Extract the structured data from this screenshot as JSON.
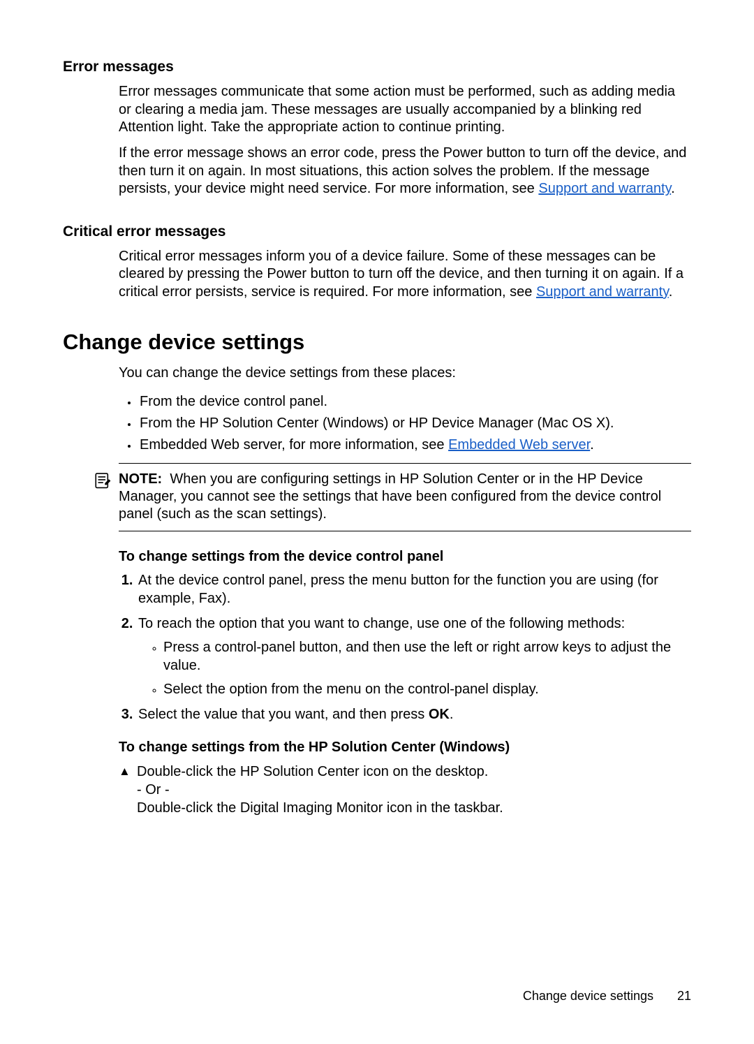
{
  "sec1": {
    "heading": "Error messages",
    "p1a": "Error messages communicate that some action must be performed, such as adding media or clearing a media jam. These messages are usually accompanied by a blinking red Attention light. Take the appropriate action to continue printing.",
    "p2a": "If the error message shows an error code, press the Power button to turn off the device, and then turn it on again. In most situations, this action solves the problem. If the message persists, your device might need service. For more information, see ",
    "p2link": "Support and warranty",
    "p2b": "."
  },
  "sec2": {
    "heading": "Critical error messages",
    "p1a": "Critical error messages inform you of a device failure. Some of these messages can be cleared by pressing the Power button to turn off the device, and then turning it on again. If a critical error persists, service is required. For more information, see ",
    "p1link": "Support and warranty",
    "p1b": "."
  },
  "sec3": {
    "heading": "Change device settings",
    "intro": "You can change the device settings from these places:",
    "bullets": {
      "b1": "From the device control panel.",
      "b2": "From the HP Solution Center (Windows) or HP Device Manager (Mac OS X).",
      "b3a": "Embedded Web server, for more information, see ",
      "b3link": "Embedded Web server",
      "b3b": "."
    },
    "note": {
      "label": "NOTE:",
      "text": "When you are configuring settings in HP Solution Center or in the HP Device Manager, you cannot see the settings that have been configured from the device control panel (such as the scan settings)."
    },
    "proc1": {
      "heading": "To change settings from the device control panel",
      "s1": "At the device control panel, press the menu button for the function you are using (for example, Fax).",
      "s2": "To reach the option that you want to change, use one of the following methods:",
      "s2a": "Press a control-panel button, and then use the left or right arrow keys to adjust the value.",
      "s2b": "Select the option from the menu on the control-panel display.",
      "s3a": "Select the value that you want, and then press ",
      "s3b": "OK",
      "s3c": "."
    },
    "proc2": {
      "heading": "To change settings from the HP Solution Center (Windows)",
      "l1": "Double-click the HP Solution Center icon on the desktop.",
      "l2": "- Or -",
      "l3": "Double-click the Digital Imaging Monitor icon in the taskbar."
    }
  },
  "footer": {
    "title": "Change device settings",
    "page": "21"
  }
}
